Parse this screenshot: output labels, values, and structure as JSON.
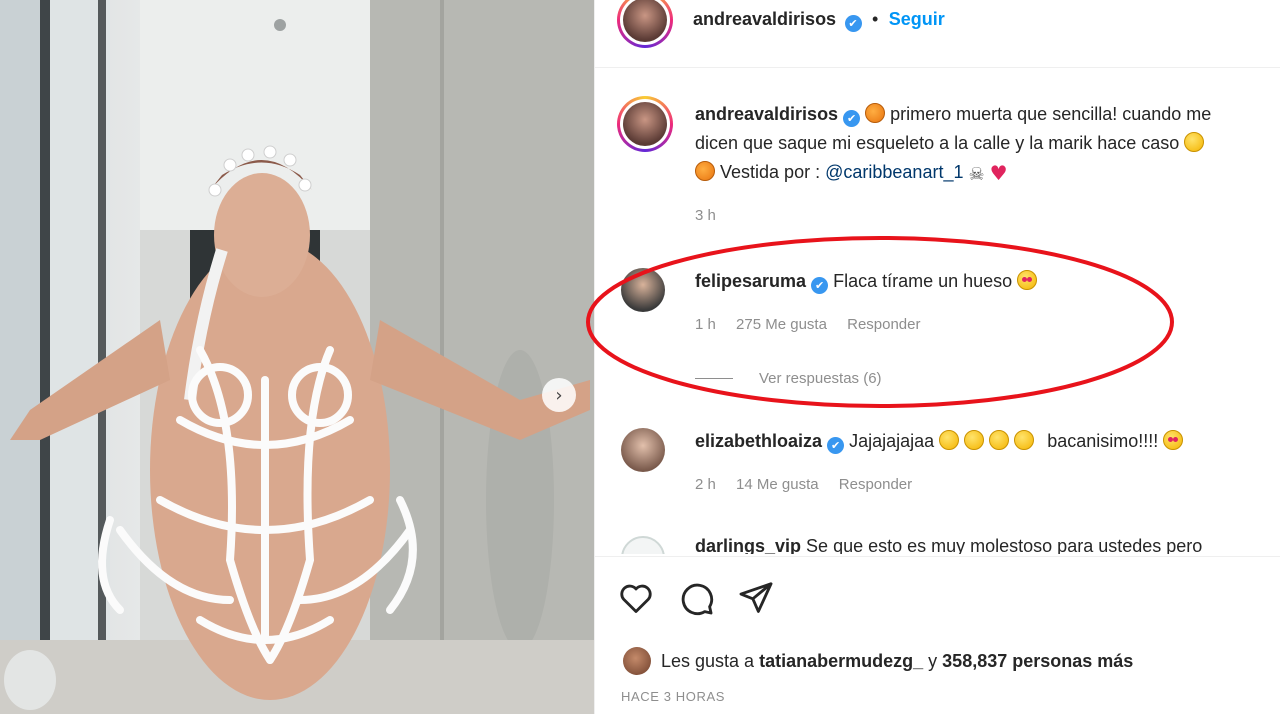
{
  "post": {
    "author": "andreavaldirisos",
    "verified_mark": "✔",
    "separator": "•",
    "follow_label": "Seguir"
  },
  "caption": {
    "author": "andreavaldirisos",
    "text_part1": "primero muerta que sencilla! cuando me dicen que saque mi esqueleto a la calle y la marik hace caso",
    "text_part2": "Vestida por :",
    "mention": "@caribbeanart_1",
    "time": "3 h",
    "emojis": [
      "pumpkin-emoji",
      "laughing-emoji",
      "pumpkin-emoji",
      "skull-crossbones-emoji",
      "red-heart-emoji"
    ]
  },
  "comments": [
    {
      "user": "felipesaruma",
      "text": "Flaca tírame un hueso",
      "time": "1 h",
      "likes": "275 Me gusta",
      "reply_label": "Responder",
      "view_replies": "Ver respuestas (6)",
      "highlighted": true
    },
    {
      "user": "elizabethloaiza",
      "text_part1": "Jajajajajaa",
      "text_part2": "bacanisimo!!!!",
      "time": "2 h",
      "likes": "14 Me gusta",
      "reply_label": "Responder"
    },
    {
      "user": "darlings_vip",
      "text": "Se que esto es muy molestoso para ustedes pero"
    }
  ],
  "footer": {
    "likes_prefix": "Les gusta a",
    "likes_user": "tatianabermudezg_",
    "likes_middle": "y",
    "likes_count": "358,837 personas más",
    "timestamp": "HACE 3 HORAS"
  },
  "colors": {
    "link_blue": "#0095f6",
    "verified_blue": "#3897f0",
    "muted_gray": "#8e8e8e",
    "annotation_red": "#e8131b"
  },
  "icons": [
    "heart-icon",
    "comment-icon",
    "share-icon",
    "carousel-next-icon",
    "verified-badge-icon"
  ]
}
